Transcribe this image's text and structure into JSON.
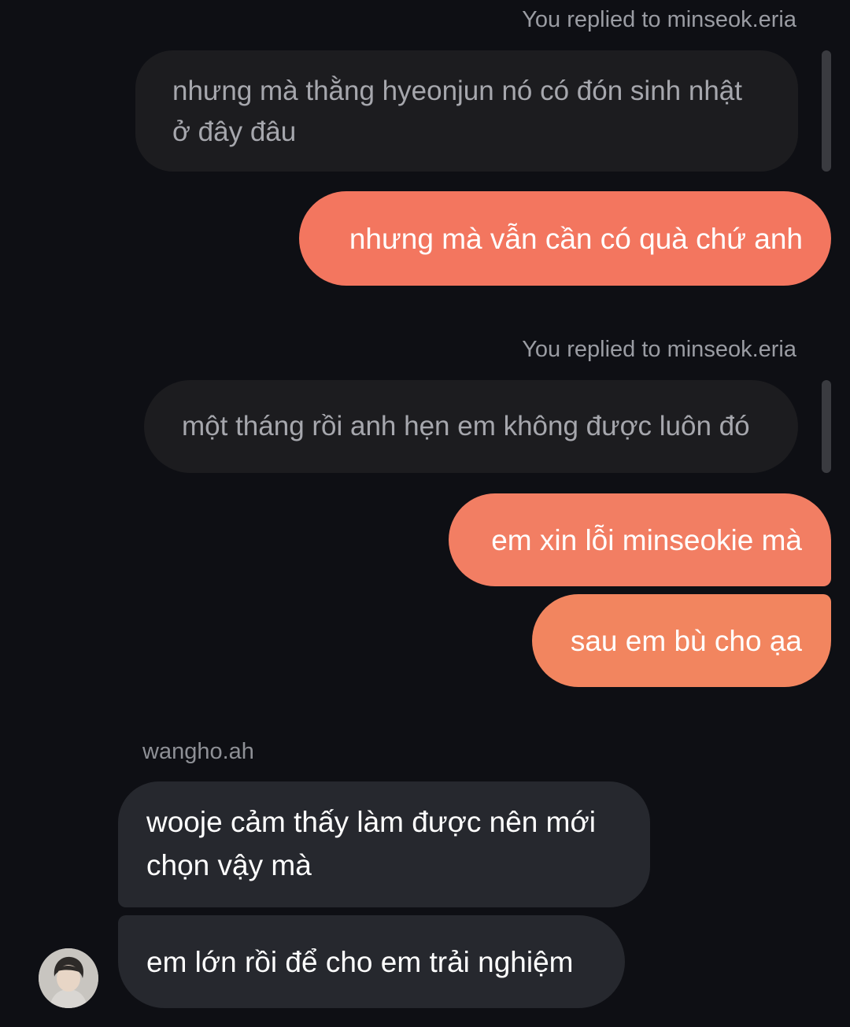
{
  "thread": {
    "reply_1": {
      "label": "You replied to minseok.eria",
      "quoted_text": "nhưng mà thằng hyeonjun nó có đón sinh nhật ở đây đâu",
      "reply_text": "nhưng mà vẫn cần có quà chứ anh"
    },
    "reply_2": {
      "label": "You replied to minseok.eria",
      "quoted_text": "một tháng rồi anh hẹn em không được luôn đó"
    },
    "sent_messages": [
      "em xin lỗi minseokie mà",
      "sau em bù cho ạa"
    ],
    "incoming": {
      "sender": "wangho.ah",
      "messages": [
        "wooje cảm thấy làm được nên mới chọn vậy mà",
        "em lớn rồi để cho em trải nghiệm"
      ]
    }
  },
  "colors": {
    "background": "#0e0f14",
    "sent_bubble": "#f3765f",
    "received_bubble": "#26282e",
    "quoted_bubble": "#1c1c1f"
  }
}
